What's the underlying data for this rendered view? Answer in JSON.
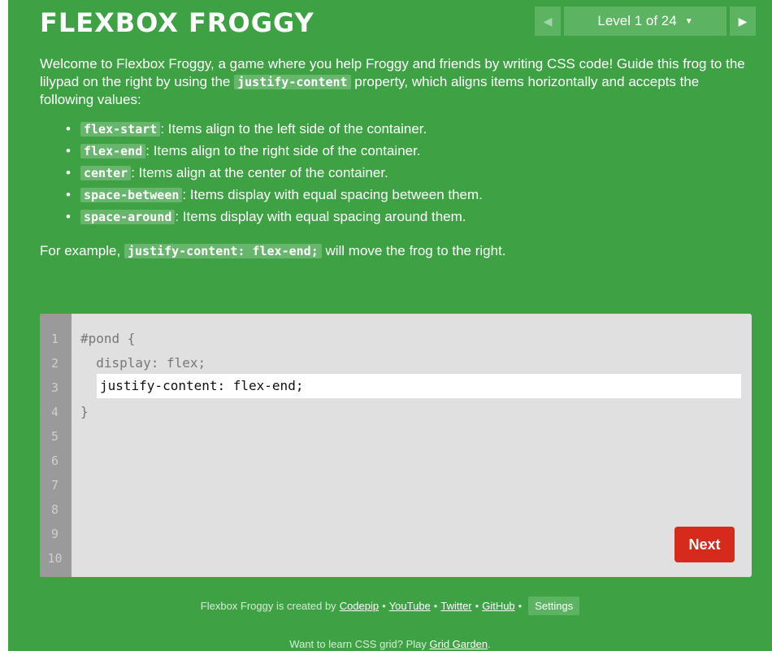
{
  "header": {
    "title": "FLEXBOX FROGGY",
    "level_label": "Level 1 of 24",
    "caret": "▼",
    "prev_arrow": "◀",
    "next_arrow": "▶"
  },
  "instructions": {
    "intro_1": "Welcome to Flexbox Froggy, a game where you help Froggy and friends by writing CSS code! Guide this frog to the lilypad on the right by using the ",
    "intro_property": "justify-content",
    "intro_2": " property, which aligns items horizontally and accepts the following values:",
    "values": [
      {
        "code": "flex-start",
        "desc": ": Items align to the left side of the container."
      },
      {
        "code": "flex-end",
        "desc": ": Items align to the right side of the container."
      },
      {
        "code": "center",
        "desc": ": Items align at the center of the container."
      },
      {
        "code": "space-between",
        "desc": ": Items display with equal spacing between them."
      },
      {
        "code": "space-around",
        "desc": ": Items display with equal spacing around them."
      }
    ],
    "example_1": "For example, ",
    "example_code": "justify-content: flex-end;",
    "example_2": " will move the frog to the right."
  },
  "editor": {
    "line_numbers": [
      "1",
      "2",
      "3",
      "4",
      "5",
      "6",
      "7",
      "8",
      "9",
      "10"
    ],
    "line_1": "#pond {",
    "line_2": "  display: flex;",
    "line_4": "}",
    "input_value": "justify-content: flex-end;",
    "next_label": "Next"
  },
  "footer": {
    "created_by": "Flexbox Froggy is created by",
    "codepip": "Codepip",
    "youtube": "YouTube",
    "twitter": "Twitter",
    "github": "GitHub",
    "sep": "•",
    "settings": "Settings",
    "grid_prefix": "Want to learn CSS grid? Play ",
    "grid_link": "Grid Garden",
    "grid_suffix": "."
  },
  "colors": {
    "background": "#3ea245",
    "next_button": "#d52a1c",
    "editor_bg": "#e0e0e0",
    "gutter_bg": "#9a9a9a"
  }
}
